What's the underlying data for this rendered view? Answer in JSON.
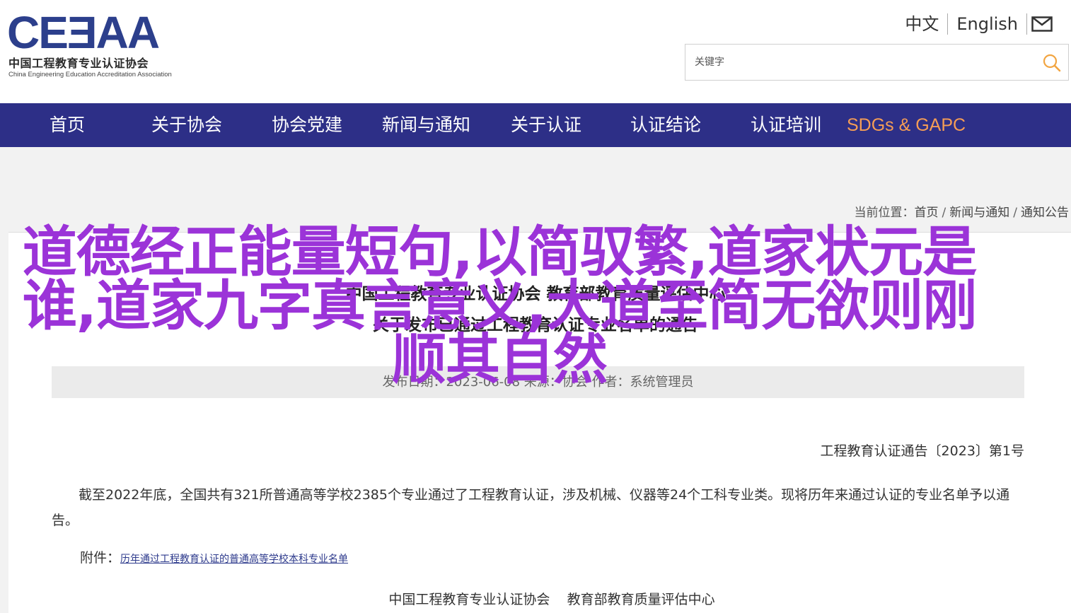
{
  "header": {
    "logo_mark": "CEƎAA",
    "logo_cn": "中国工程教育专业认证协会",
    "logo_en": "China Engineering Education Accreditation Association",
    "lang_cn": "中文",
    "lang_en": "English",
    "mail_icon": "mail-icon",
    "search_placeholder": "关键字",
    "search_icon": "search-icon"
  },
  "nav": {
    "items": [
      {
        "label": "首页"
      },
      {
        "label": "关于协会"
      },
      {
        "label": "协会党建"
      },
      {
        "label": "新闻与通知"
      },
      {
        "label": "关于认证"
      },
      {
        "label": "认证结论"
      },
      {
        "label": "认证培训"
      },
      {
        "label": "SDGs & GAPC"
      }
    ]
  },
  "breadcrumb": {
    "prefix": "当前位置：",
    "items": [
      "首页",
      "新闻与通知",
      "通知公告"
    ],
    "separator": "/"
  },
  "article": {
    "title_line1": "中国工程教育专业认证协会 教育部教育质量评估中心",
    "title_line2": "关于发布已通过工程教育认证专业名单的通告",
    "meta": "发布日期：2023-06-08  来源：协会  作者：系统管理员",
    "doc_number": "工程教育认证通告〔2023〕第1号",
    "body": "截至2022年底，全国共有321所普通高等学校2385个专业通过了工程教育认证，涉及机械、仪器等24个工科专业类。现将历年来通过认证的专业名单予以通告。",
    "attachment_label": "附件：",
    "attachment_link": "历年通过工程教育认证的普通高等学校本科专业名单",
    "signature": "中国工程教育专业认证协会    教育部教育质量评估中心"
  },
  "overlay": {
    "text": "道德经正能量短句,以简驭繁,道家状元是谁,道家九字真言意义,大道至简无欲则刚顺其自然",
    "color": "#9b33d8"
  },
  "colors": {
    "nav_bg": "#2d2f87",
    "nav_accent": "#f59d55",
    "logo_blue": "#2c3f8c",
    "search_icon": "#f2a541"
  }
}
